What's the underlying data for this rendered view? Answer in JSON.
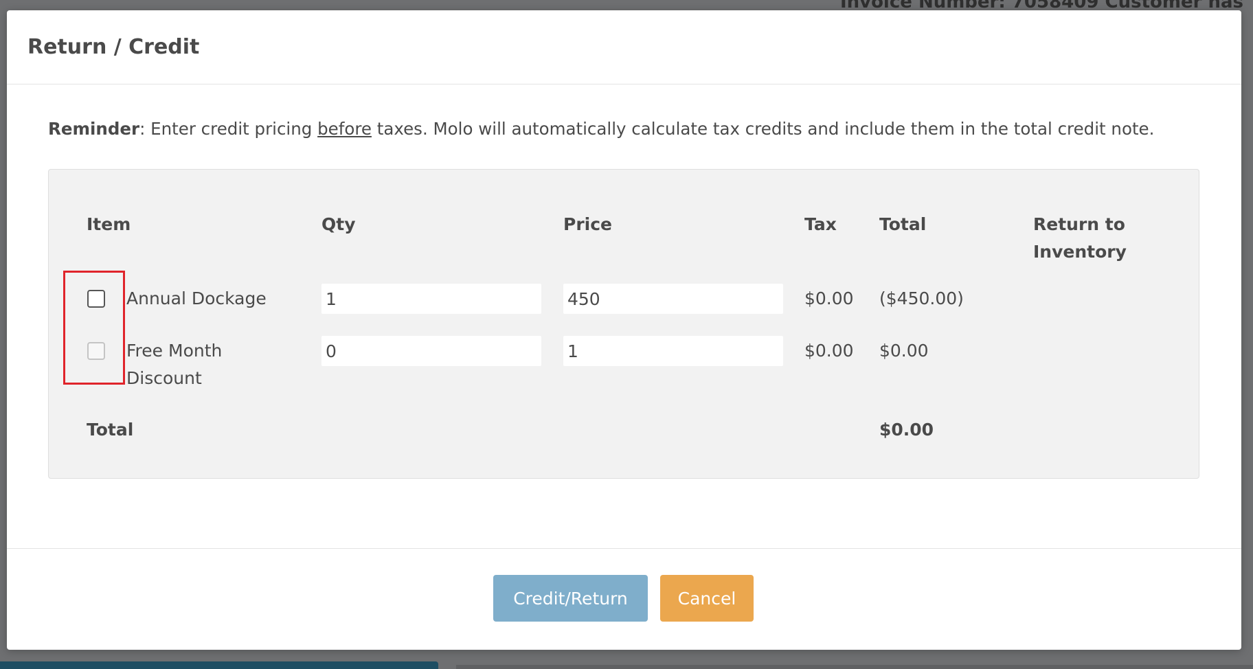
{
  "background": {
    "top_text": "Invoice Number: 7058409  Customer has"
  },
  "modal": {
    "title": "Return / Credit",
    "reminder": {
      "label": "Reminder",
      "text_before": ": Enter credit pricing ",
      "emphasis": "before",
      "text_after": " taxes. Molo will automatically calculate tax credits and include them in the total credit note."
    },
    "table": {
      "headers": {
        "item": "Item",
        "qty": "Qty",
        "price": "Price",
        "tax": "Tax",
        "total": "Total",
        "return_line1": "Return to",
        "return_line2": "Inventory"
      },
      "rows": [
        {
          "checked": false,
          "disabled": false,
          "item": "Annual Dockage",
          "qty": "1",
          "price": "450",
          "tax": "$0.00",
          "total": "($450.00)"
        },
        {
          "checked": false,
          "disabled": true,
          "item_line1": "Free Month",
          "item_line2": "Discount",
          "qty": "0",
          "price": "1",
          "tax": "$0.00",
          "total": "$0.00"
        }
      ],
      "footer": {
        "label": "Total",
        "value": "$0.00"
      }
    },
    "buttons": {
      "primary": "Credit/Return",
      "cancel": "Cancel"
    }
  },
  "colors": {
    "overlay": "#6e6f71",
    "primary_button": "#7faecb",
    "cancel_button": "#eba74e",
    "highlight": "#e0242b"
  }
}
